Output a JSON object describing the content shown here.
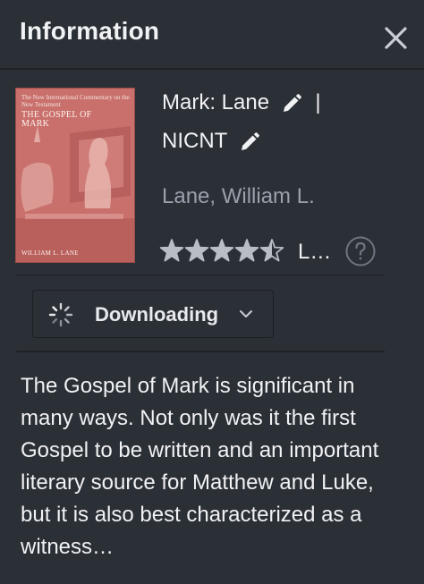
{
  "header": {
    "title": "Information",
    "close_icon": "close-icon"
  },
  "book": {
    "cover": {
      "series": "The New International Commentary on the New Testament",
      "title": "THE GOSPEL OF MARK",
      "author": "WILLIAM L. LANE",
      "background_color": "#c9706c"
    },
    "title_line1": "Mark: Lane",
    "separator": "|",
    "title_line2": "NICNT",
    "edit_icon": "pencil-icon",
    "author": "Lane, William L.",
    "rating": 4.5,
    "rating_max": 5,
    "rating_label": "L…",
    "help_icon": "question-circle-icon"
  },
  "download": {
    "label": "Downloading",
    "spinner_icon": "spinner-icon",
    "chevron_icon": "chevron-down-icon"
  },
  "description": "The Gospel of Mark is significant in many ways. Not only was it the first Gospel to be written and an important literary source for Matthew and Luke, but it is also best characterized as a witness…",
  "colors": {
    "background": "#2b2f36",
    "text": "#f1f2f4",
    "muted": "#9aa1ab",
    "star": "#b9bec5"
  }
}
